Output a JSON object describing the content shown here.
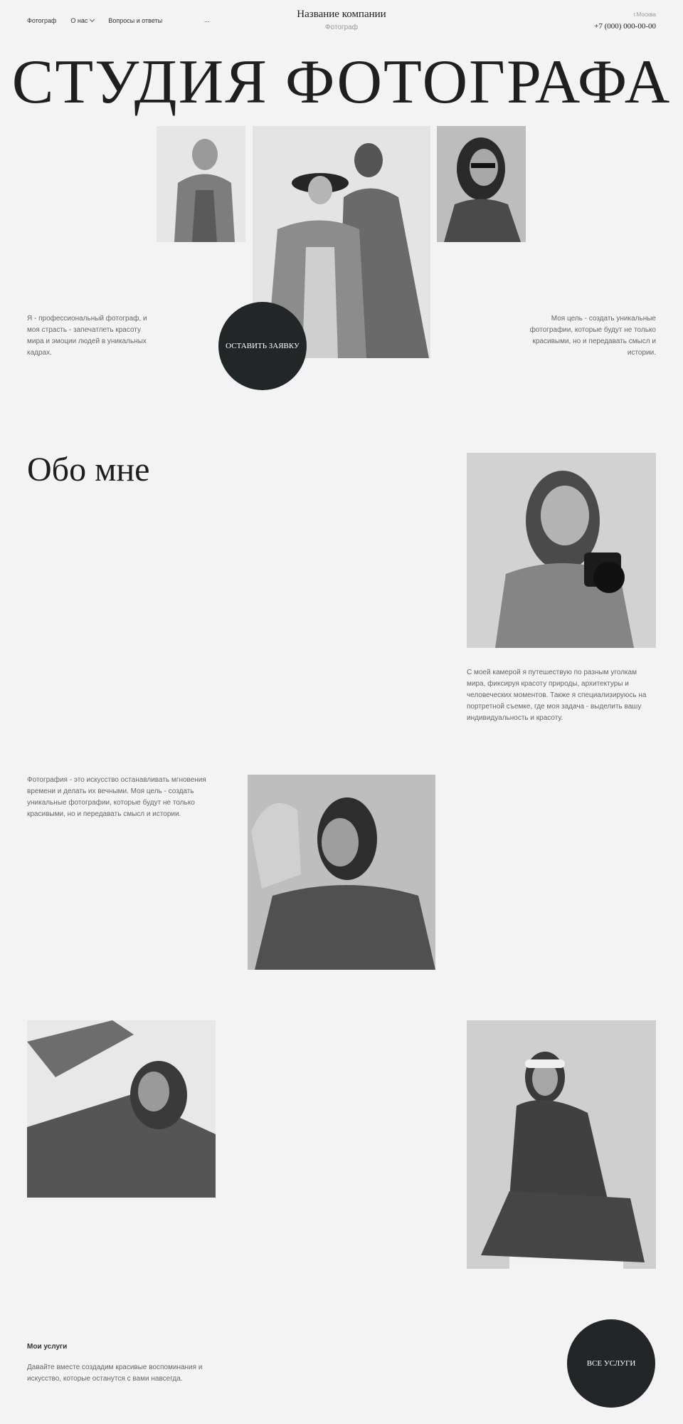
{
  "header": {
    "nav": [
      {
        "label": "Фотограф"
      },
      {
        "label": "О нас"
      },
      {
        "label": "Вопросы и ответы"
      }
    ],
    "more": "...",
    "company": "Название компании",
    "company_sub": "Фотограф",
    "city": "г.Москва",
    "phone": "+7 (000) 000-00-00"
  },
  "hero": {
    "title": "СТУДИЯ ФОТОГРАФА",
    "left_text": "Я - профессиональный фотограф, и моя страсть - запечатлеть красоту мира и эмоции людей в уникальных кадрах.",
    "right_text": "Моя цель - создать уникальные фотографии, которые будут не только красивыми, но и передавать смысл и истории.",
    "cta": "ОСТАВИТЬ ЗАЯВКУ"
  },
  "about": {
    "title": "Обо мне",
    "text": "С моей камерой я путешествую по разным уголкам мира, фиксируя красоту природы, архитектуры и человеческих моментов. Также я специализируюсь на портретной съемке, где моя задача - выделить вашу индивидуальность и красоту."
  },
  "art": {
    "text": "Фотография - это искусство останавливать мгновения времени и делать их вечными. Моя цель - создать уникальные фотографии, которые будут не только красивыми, но и передавать смысл и истории."
  },
  "services": {
    "title": "Мои услуги",
    "text": "Давайте вместе создадим красивые воспоминания и искусство, которые останутся с вами навсегда.",
    "button": "ВСЕ УСЛУГИ"
  },
  "colors": {
    "background": "#f3f3f3",
    "button": "#232626",
    "text": "#222222",
    "muted": "#666666"
  }
}
